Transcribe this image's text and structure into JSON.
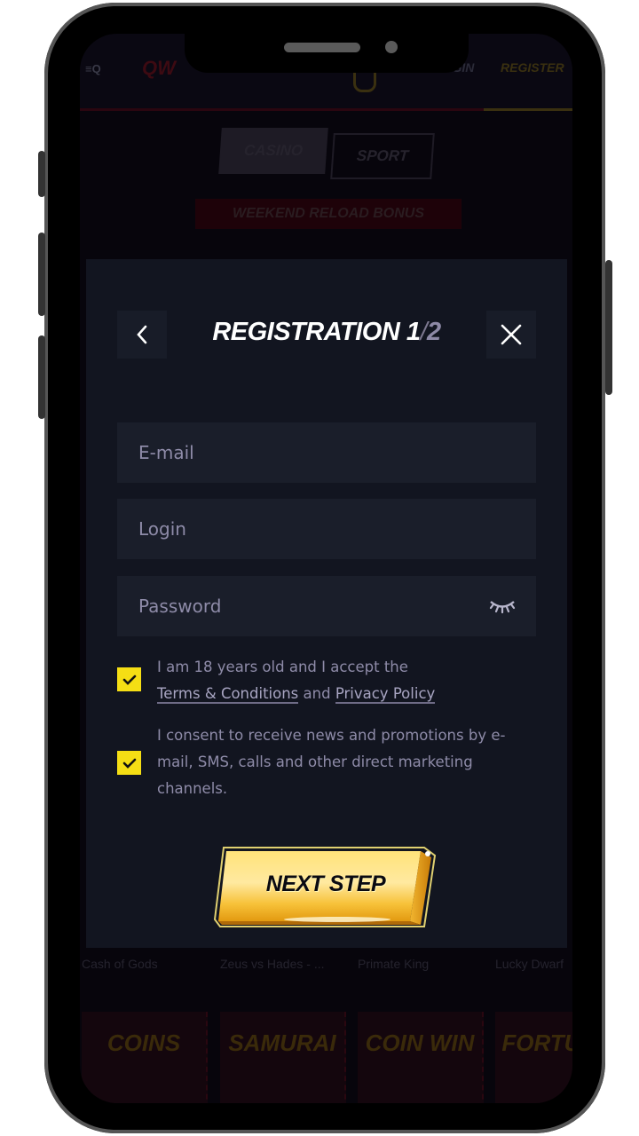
{
  "background_site": {
    "header": {
      "logo_text": "QW",
      "login_label": "LOGIN",
      "register_label": "REGISTER"
    },
    "tabs": [
      {
        "label": "CASINO",
        "active": true
      },
      {
        "label": "SPORT",
        "active": false
      }
    ],
    "promo_banner": "WEEKEND RELOAD BONUS",
    "games": [
      {
        "name": "Cash of Gods",
        "tile_text": "COINS"
      },
      {
        "name": "Zeus vs Hades - ...",
        "tile_text": "SAMURAI"
      },
      {
        "name": "Primate King",
        "tile_text": "COIN WIN"
      },
      {
        "name": "Lucky Dwarf",
        "tile_text": "FORTUNE"
      }
    ]
  },
  "modal": {
    "title": "REGISTRATION 1",
    "step_separator": "/",
    "step_total": "2",
    "back_icon": "chevron-left-icon",
    "close_icon": "close-icon",
    "fields": {
      "email": {
        "placeholder": "E-mail",
        "value": ""
      },
      "login": {
        "placeholder": "Login",
        "value": ""
      },
      "password": {
        "placeholder": "Password",
        "value": "",
        "toggle_icon": "eye-closed-icon"
      }
    },
    "checkboxes": {
      "terms": {
        "checked": true,
        "text_before": "I am 18 years old and I accept the ",
        "terms_link": "Terms & Conditions",
        "middle": " and ",
        "privacy_link": "Privacy Policy"
      },
      "marketing": {
        "checked": true,
        "text": "I consent to receive news and promotions by e-mail, SMS, calls and other direct marketing channels."
      }
    },
    "next_button": "NEXT STEP"
  },
  "colors": {
    "accent_yellow": "#f5de14",
    "modal_bg": "#121520",
    "field_bg": "#1a1e2a",
    "placeholder": "#8e8ba8"
  }
}
